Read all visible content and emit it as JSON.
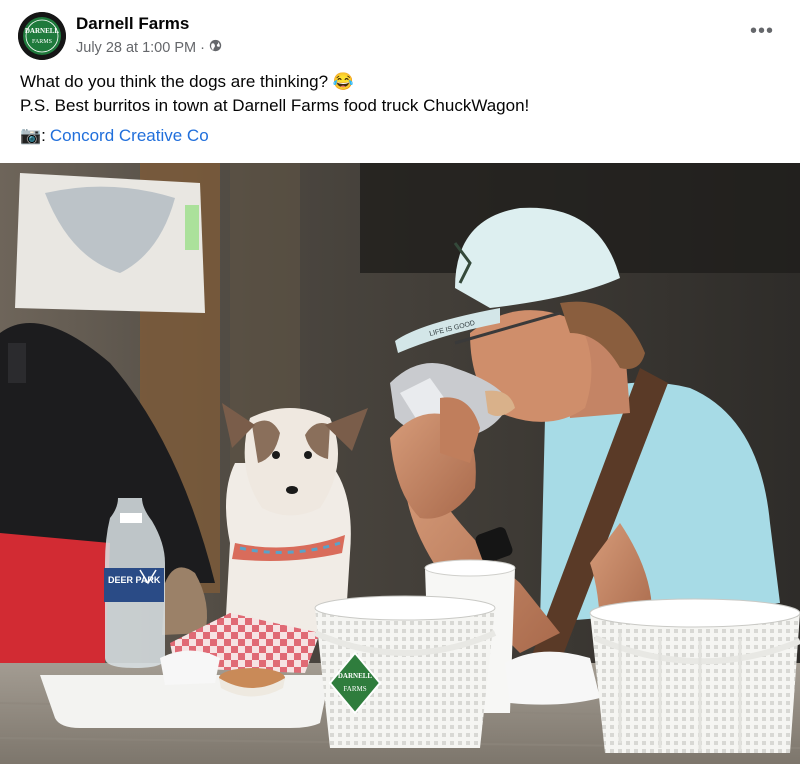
{
  "post": {
    "author": "Darnell Farms",
    "avatar_text_top": "DARNELL",
    "avatar_text_bottom": "FARMS",
    "date": "July 28 at 1:00 PM",
    "separator": "·",
    "audience_icon": "globe-icon",
    "more_label": "•••",
    "lines": [
      "What do you think the dogs are thinking? 😂",
      "P.S. Best burritos in town at Darnell Farms food truck ChuckWagon!"
    ],
    "credit": {
      "icon": "📷",
      "separator": ":",
      "link_text": "Concord Creative Co"
    }
  },
  "photo": {
    "cap_text": "LIFE IS GOOD",
    "bottle_brand": "DEER PARK",
    "basket_logo_top": "DARNELL",
    "basket_logo_bottom": "FARMS"
  },
  "colors": {
    "link": "#216fdb",
    "meta": "#65676b",
    "brand_green": "#1f7a3c"
  }
}
